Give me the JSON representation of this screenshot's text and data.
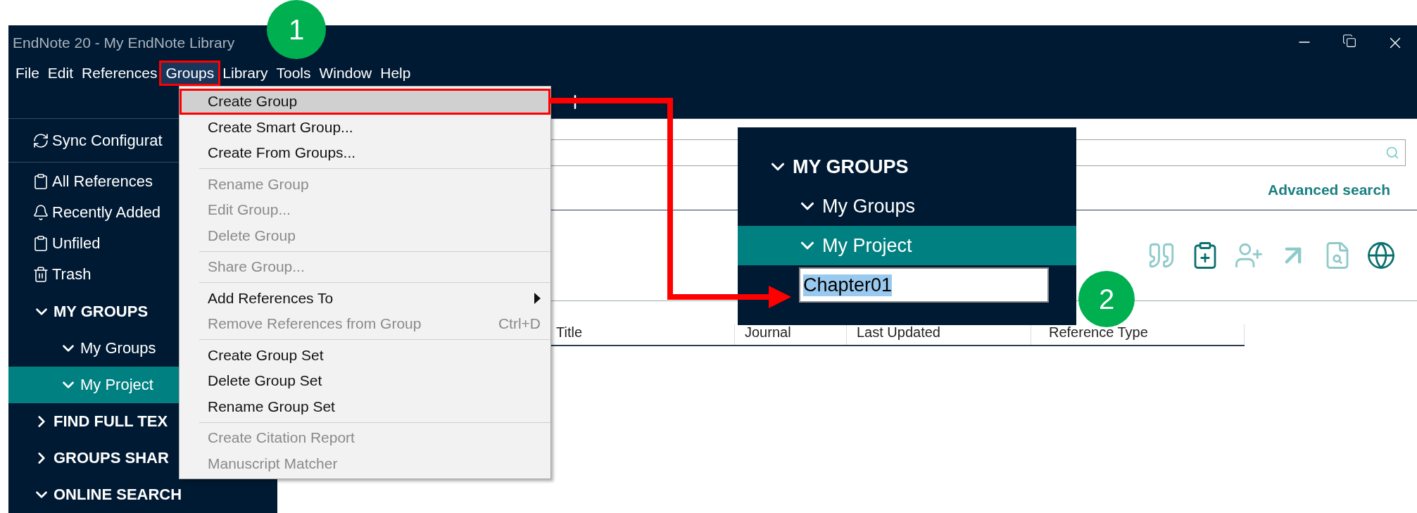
{
  "window": {
    "title": "EndNote 20 - My EndNote Library"
  },
  "menu_bar": [
    {
      "label": "File",
      "selected": false
    },
    {
      "label": "Edit",
      "selected": false
    },
    {
      "label": "References",
      "selected": false
    },
    {
      "label": "Groups",
      "selected": true
    },
    {
      "label": "Library",
      "selected": false
    },
    {
      "label": "Tools",
      "selected": false
    },
    {
      "label": "Window",
      "selected": false
    },
    {
      "label": "Help",
      "selected": false
    }
  ],
  "sidebar": {
    "sync": "Sync Configurat",
    "library": [
      {
        "label": "All References",
        "selected": false
      },
      {
        "label": "Recently Added",
        "selected": false
      },
      {
        "label": "Unfiled",
        "selected": false
      },
      {
        "label": "Trash",
        "selected": false
      }
    ],
    "sections": [
      {
        "label": "MY GROUPS",
        "expanded": true,
        "children": [
          {
            "label": "My Groups",
            "expanded": true,
            "selected": false
          },
          {
            "label": "My Project",
            "expanded": true,
            "selected": true
          }
        ]
      },
      {
        "label": "FIND FULL TEX",
        "expanded": false
      },
      {
        "label": "GROUPS SHAR",
        "expanded": false
      },
      {
        "label": "ONLINE SEARCH",
        "expanded": true
      }
    ]
  },
  "groups_menu": [
    [
      {
        "label": "Create Group",
        "selected": true,
        "disabled": false,
        "submenu": false
      },
      {
        "label": "Create Smart Group...",
        "selected": false,
        "disabled": false,
        "submenu": false
      },
      {
        "label": "Create From Groups...",
        "selected": false,
        "disabled": false,
        "submenu": false
      }
    ],
    [
      {
        "label": "Rename Group",
        "selected": false,
        "disabled": true,
        "submenu": false
      },
      {
        "label": "Edit Group...",
        "selected": false,
        "disabled": true,
        "submenu": false
      },
      {
        "label": "Delete Group",
        "selected": false,
        "disabled": true,
        "submenu": false
      }
    ],
    [
      {
        "label": "Share Group...",
        "selected": false,
        "disabled": true,
        "submenu": false
      }
    ],
    [
      {
        "label": "Add References To",
        "selected": false,
        "disabled": false,
        "submenu": true
      },
      {
        "label": "Remove References from Group",
        "shortcut": "Ctrl+D",
        "selected": false,
        "disabled": true,
        "submenu": false
      }
    ],
    [
      {
        "label": "Create Group Set",
        "selected": false,
        "disabled": false,
        "submenu": false
      },
      {
        "label": "Delete Group Set",
        "selected": false,
        "disabled": false,
        "submenu": false
      },
      {
        "label": "Rename Group Set",
        "selected": false,
        "disabled": false,
        "submenu": false
      }
    ],
    [
      {
        "label": "Create Citation Report",
        "selected": false,
        "disabled": true,
        "submenu": false
      },
      {
        "label": "Manuscript Matcher",
        "selected": false,
        "disabled": true,
        "submenu": false
      }
    ]
  ],
  "advanced_search": "Advanced search",
  "table": {
    "columns": [
      "Title",
      "Journal",
      "Last Updated",
      "Reference Type"
    ]
  },
  "inset": {
    "section": {
      "label": "MY GROUPS",
      "expanded": true
    },
    "items": [
      {
        "label": "My Groups",
        "expanded": true,
        "selected": false
      },
      {
        "label": "My Project",
        "expanded": true,
        "selected": true
      }
    ],
    "new_group": {
      "value": "Chapter01",
      "text_selected": true
    }
  },
  "step_badges": [
    "1",
    "2"
  ]
}
